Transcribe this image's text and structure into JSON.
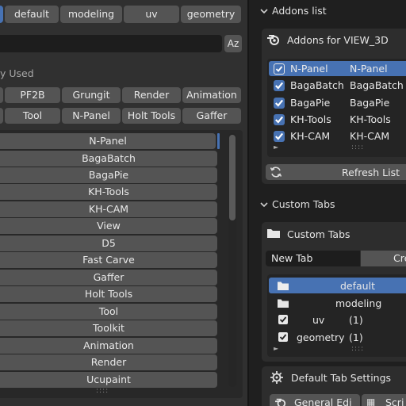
{
  "top_tabs": [
    "default",
    "modeling",
    "uv",
    "geometry"
  ],
  "sort_label": "y Used",
  "row1": [
    "PF2B",
    "Grungit",
    "Render",
    "Animation"
  ],
  "row2": [
    "Tool",
    "N-Panel",
    "Holt Tools",
    "Gaffer"
  ],
  "list_items": [
    "N-Panel",
    "BagaBatch",
    "BagaPie",
    "KH-Tools",
    "KH-CAM",
    "View",
    "D5",
    "Fast Carve",
    "Gaffer",
    "Holt Tools",
    "Tool",
    "Toolkit",
    "Animation",
    "Render",
    "Ucupaint"
  ],
  "sort_icon": "Az",
  "right": {
    "addons_list_header": "Addons list",
    "addons_for_label": "Addons for VIEW_3D",
    "addons": [
      {
        "name": "N-Panel",
        "tab": "N-Panel",
        "checked": true
      },
      {
        "name": "BagaBatch",
        "tab": "BagaBatch",
        "checked": true
      },
      {
        "name": "BagaPie",
        "tab": "BagaPie",
        "checked": true
      },
      {
        "name": "KH-Tools",
        "tab": "KH-Tools",
        "checked": true
      },
      {
        "name": "KH-CAM",
        "tab": "KH-CAM",
        "checked": true
      }
    ],
    "refresh_label": "Refresh List",
    "custom_tabs_header": "Custom Tabs",
    "custom_tabs_label": "Custom Tabs",
    "new_tab_value": "New Tab",
    "create_label": "Cre",
    "tabs": [
      {
        "name": "default",
        "count": ""
      },
      {
        "name": "modeling",
        "count": ""
      },
      {
        "name": "uv",
        "count": "(1)"
      },
      {
        "name": "geometry",
        "count": "(1)"
      }
    ],
    "default_tab_settings_label": "Default Tab Settings",
    "general_edit_label": "General Edi",
    "script_label": "Scri"
  },
  "colors": {
    "accent": "#4772b3",
    "button": "#545454",
    "panel": "#2b2b2b",
    "bg": "#1d1d1d"
  }
}
